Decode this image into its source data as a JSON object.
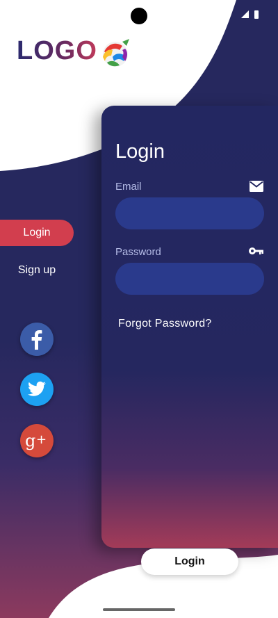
{
  "logo": {
    "text": "LOGO",
    "globe_icon": "globe-logo-icon"
  },
  "card": {
    "title": "Login",
    "email": {
      "label": "Email",
      "value": "",
      "icon": "mail-icon"
    },
    "password": {
      "label": "Password",
      "value": "",
      "icon": "key-icon"
    },
    "forgot_label": "Forgot Password?"
  },
  "side_nav": {
    "items": [
      {
        "label": "Login",
        "selected": true
      },
      {
        "label": "Sign up",
        "selected": false
      }
    ]
  },
  "social": [
    {
      "name": "facebook",
      "glyph": "f",
      "color": "#3b5ca8",
      "icon": "facebook-icon"
    },
    {
      "name": "twitter",
      "color": "#1da1f2",
      "icon": "twitter-icon"
    },
    {
      "name": "google-plus",
      "glyph": "g+",
      "color": "#d54a3b",
      "icon": "google-plus-icon"
    }
  ],
  "bottom_button": {
    "label": "Login"
  },
  "colors": {
    "primary_dark": "#26285e",
    "accent_red": "#d23e4e",
    "input_fill": "#2a3a8c"
  }
}
